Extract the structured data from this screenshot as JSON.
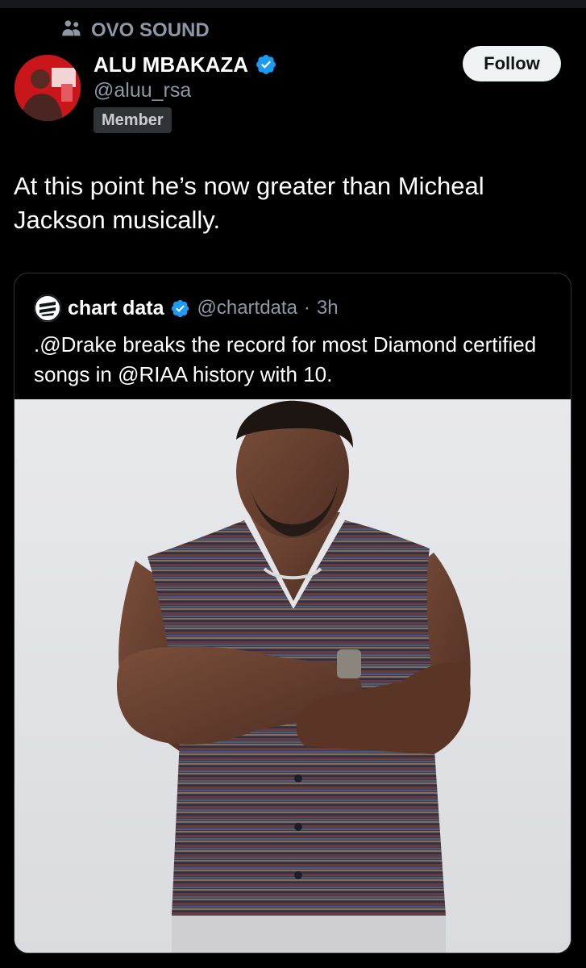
{
  "community": {
    "icon": "community-icon",
    "name": "OVO SOUND"
  },
  "post": {
    "author": {
      "display_name": "ALU MBAKAZA",
      "handle": "@aluu_rsa",
      "verified": true,
      "badge": "Member"
    },
    "follow_label": "Follow",
    "text": "At this point he’s now greater than Micheal\nJackson musically."
  },
  "quoted_post": {
    "author": {
      "display_name": "chart data",
      "handle": "@chartdata",
      "verified": true
    },
    "separator": "·",
    "time": "3h",
    "text": ".@Drake breaks the record for most Diamond certified songs in @RIAA history with 10."
  },
  "colors": {
    "background": "#000000",
    "verified_blue": "#1d9bf0",
    "secondary_text": "#8b98a5",
    "follow_button_bg": "#eff3f4"
  }
}
